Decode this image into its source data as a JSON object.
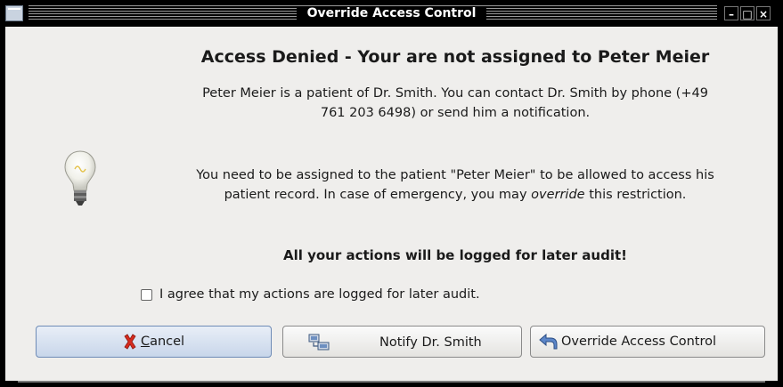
{
  "window": {
    "title": "Override Access Control"
  },
  "dialog": {
    "heading": "Access Denied - Your are not assigned to Peter Meier",
    "paragraph1": "Peter Meier is a patient of Dr. Smith. You can contact Dr. Smith by phone (+49 761 203 6498) or send him a notification.",
    "paragraph2_before": "You need to be assigned to the patient \"Peter Meier\" to be allowed to access his patient record. In case of emergency, you may ",
    "paragraph2_emphasis": "override",
    "paragraph2_after": " this restriction.",
    "warning": "All your actions will be logged for later audit!",
    "agree_label": "I agree that my actions are logged for later audit.",
    "agree_checked": false
  },
  "buttons": {
    "cancel_accel": "C",
    "cancel_rest": "ancel",
    "notify": "Notify Dr. Smith",
    "override": "Override Access Control"
  },
  "icons": {
    "hint": "lightbulb-icon",
    "cancel": "cancel-x-icon",
    "notify": "network-computers-icon",
    "override": "undo-arrow-icon"
  },
  "colors": {
    "titlebar": "#000000",
    "client_bg": "#efeeec",
    "default_button": "#c8d6ea",
    "cancel_icon": "#d62b1e"
  }
}
